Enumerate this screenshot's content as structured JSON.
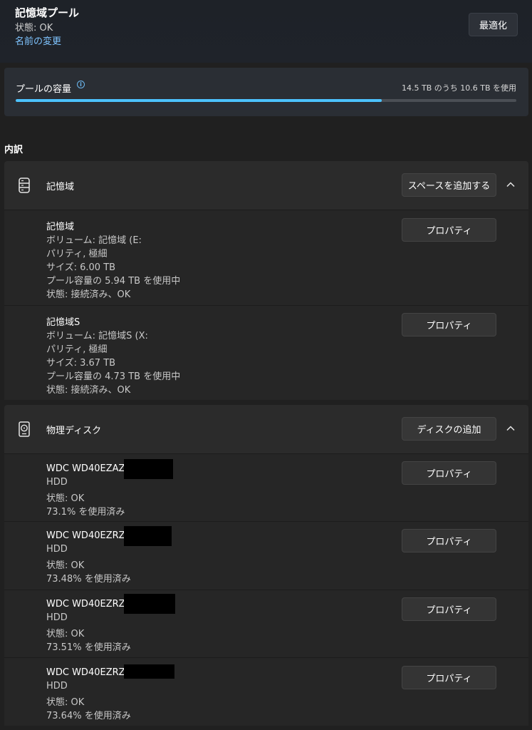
{
  "header": {
    "title": "記憶域プール",
    "status": "状態: OK",
    "rename_link": "名前の変更",
    "optimize_button": "最適化"
  },
  "capacity": {
    "label": "プールの容量",
    "usage_text": "14.5 TB のうち 10.6 TB を使用",
    "used_fraction": 0.731
  },
  "breakdown_heading": "内訳",
  "storage_spaces": {
    "title": "記憶域",
    "add_button": "スペースを追加する",
    "icon": "server-icon",
    "items": [
      {
        "name": "記憶域",
        "lines": [
          "ボリューム: 記憶域 (E:",
          "パリティ, 極細",
          "サイズ: 6.00 TB",
          "プール容量の 5.94 TB を使用中",
          "状態: 接続済み、OK"
        ],
        "button": "プロパティ"
      },
      {
        "name": "記憶域S",
        "lines": [
          "ボリューム: 記憶域S (X:",
          "パリティ, 極細",
          "サイズ: 3.67 TB",
          "プール容量の 4.73 TB を使用中",
          "状態: 接続済み、OK"
        ],
        "button": "プロパティ"
      }
    ]
  },
  "physical_disks": {
    "title": "物理ディスク",
    "add_button": "ディスクの追加",
    "icon": "hard-disk-icon",
    "items": [
      {
        "name": "WDC WD40EZAZ",
        "lines": [
          "HDD",
          "状態: OK",
          "73.1% を使用済み"
        ],
        "button": "プロパティ"
      },
      {
        "name": "WDC WD40EZRZ",
        "lines": [
          "HDD",
          "状態: OK",
          "73.48% を使用済み"
        ],
        "button": "プロパティ"
      },
      {
        "name": "WDC WD40EZRZ",
        "lines": [
          "HDD",
          "状態: OK",
          "73.51% を使用済み"
        ],
        "button": "プロパティ"
      },
      {
        "name": "WDC WD40EZRZ",
        "lines": [
          "HDD",
          "状態: OK",
          "73.64% を使用済み"
        ],
        "button": "プロパティ"
      }
    ]
  },
  "colors": {
    "accent": "#4cc2ff",
    "link": "#7fc4ff",
    "background": "#202020"
  }
}
